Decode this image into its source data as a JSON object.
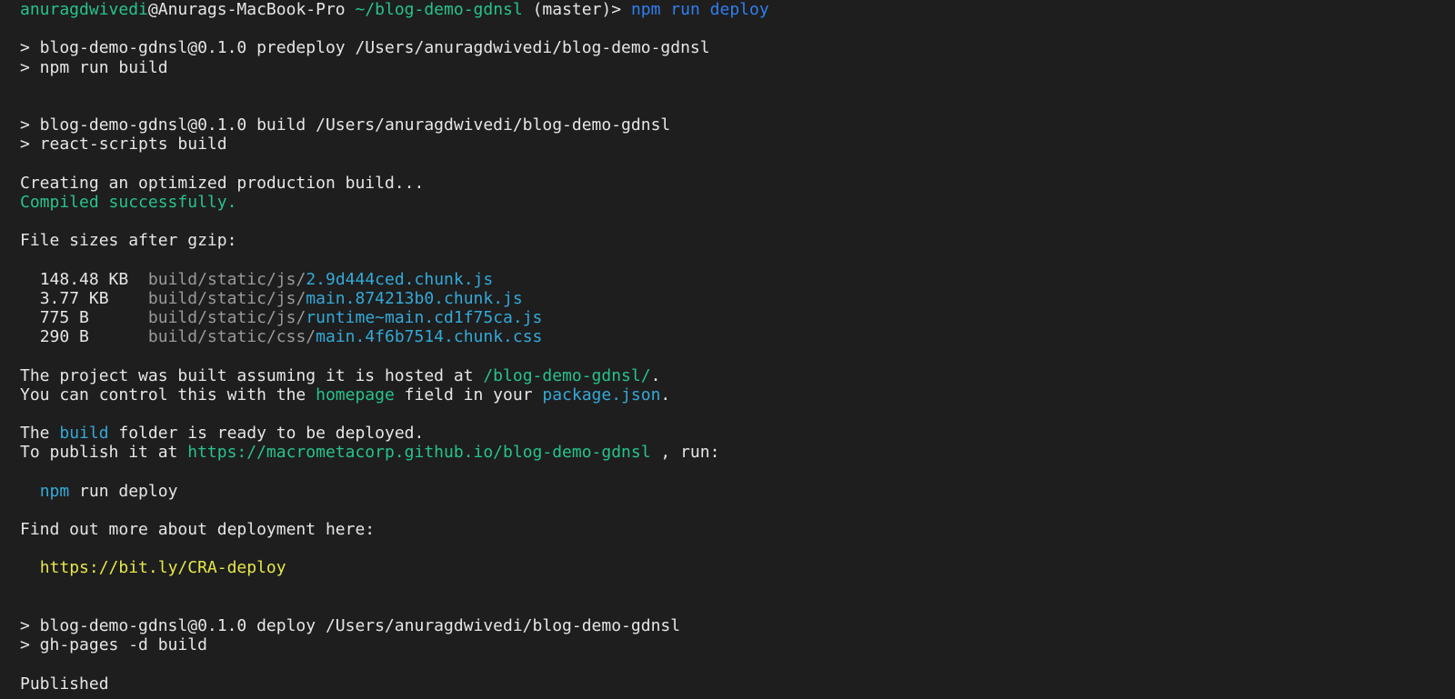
{
  "colors": {
    "background": "#1e1e1e",
    "text": "#e6e6e6",
    "green": "#27c38b",
    "blue": "#2f7ff0",
    "cyan": "#34a9d8",
    "gray": "#9a9a9a",
    "yellow": "#e5e84a"
  },
  "prompt": {
    "user": "anuragdwivedi",
    "at_host": "@Anurags-MacBook-Pro",
    "path": "~/blog-demo-gdnsl",
    "branch": "(master)>",
    "command": "npm run deploy"
  },
  "predeploy": {
    "line1": "> blog-demo-gdnsl@0.1.0 predeploy /Users/anuragdwivedi/blog-demo-gdnsl",
    "line2": "> npm run build"
  },
  "build": {
    "line1": "> blog-demo-gdnsl@0.1.0 build /Users/anuragdwivedi/blog-demo-gdnsl",
    "line2": "> react-scripts build"
  },
  "creating": "Creating an optimized production build...",
  "compiled": "Compiled successfully.",
  "file_sizes_header": "File sizes after gzip:",
  "files": [
    {
      "size": "148.48 KB",
      "dir": "build/static/js/",
      "name": "2.9d444ced.chunk.js"
    },
    {
      "size": "3.77 KB",
      "dir": "build/static/js/",
      "name": "main.874213b0.chunk.js"
    },
    {
      "size": "775 B",
      "dir": "build/static/js/",
      "name": "runtime~main.cd1f75ca.js"
    },
    {
      "size": "290 B",
      "dir": "build/static/css/",
      "name": "main.4f6b7514.chunk.css"
    }
  ],
  "hosted": {
    "prefix": "The project was built assuming it is hosted at ",
    "path": "/blog-demo-gdnsl/",
    "suffix": "."
  },
  "control": {
    "prefix": "You can control this with the ",
    "field": "homepage",
    "middle": " field in your ",
    "file": "package.json",
    "suffix": "."
  },
  "ready": {
    "prefix": "The ",
    "folder": "build",
    "suffix": " folder is ready to be deployed."
  },
  "publish": {
    "prefix": "To publish it at ",
    "url": "https://macrometacorp.github.io/blog-demo-gdnsl",
    "suffix": " , run:"
  },
  "deploy_cmd": {
    "npm": "npm",
    "rest": " run deploy"
  },
  "find_out": "Find out more about deployment here:",
  "cra_link": "https://bit.ly/CRA-deploy",
  "deploy": {
    "line1": "> blog-demo-gdnsl@0.1.0 deploy /Users/anuragdwivedi/blog-demo-gdnsl",
    "line2": "> gh-pages -d build"
  },
  "published": "Published"
}
